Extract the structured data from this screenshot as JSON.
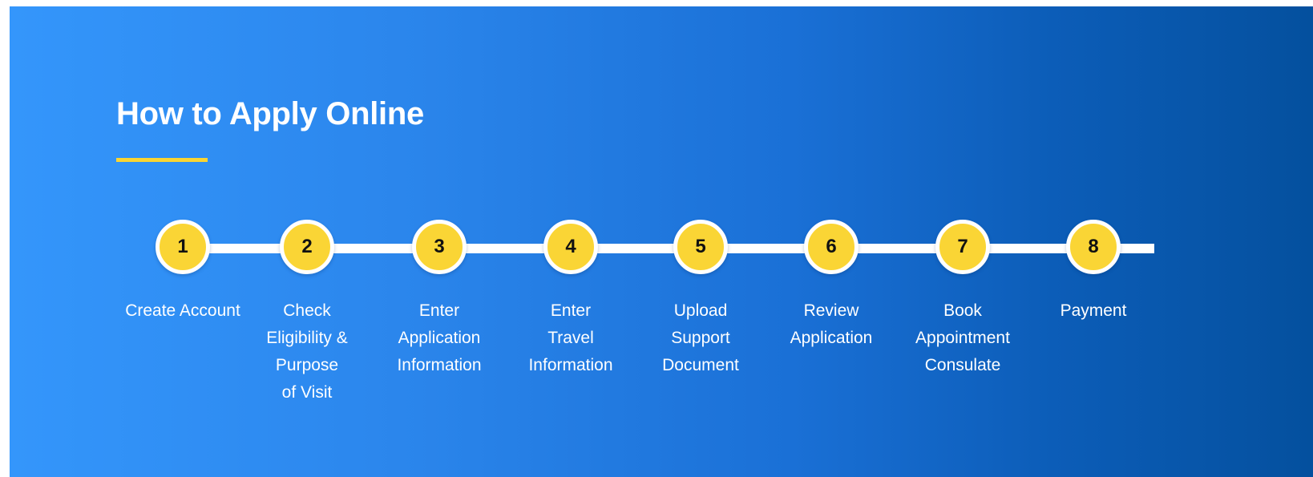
{
  "title": "How to Apply Online",
  "colors": {
    "background_start": "#3496fb",
    "background_end": "#04509e",
    "accent": "#fad535",
    "text": "#ffffff",
    "step_number": "#111111"
  },
  "steps": [
    {
      "number": "1",
      "lines": [
        "Create Account"
      ]
    },
    {
      "number": "2",
      "lines": [
        "Check",
        "Eligibility &",
        "Purpose",
        "of Visit"
      ]
    },
    {
      "number": "3",
      "lines": [
        "Enter",
        "Application",
        "Information"
      ]
    },
    {
      "number": "4",
      "lines": [
        "Enter",
        "Travel",
        "Information"
      ]
    },
    {
      "number": "5",
      "lines": [
        "Upload",
        "Support",
        "Document"
      ]
    },
    {
      "number": "6",
      "lines": [
        "Review",
        "Application"
      ]
    },
    {
      "number": "7",
      "lines": [
        "Book",
        "Appointment",
        "Consulate"
      ]
    },
    {
      "number": "8",
      "lines": [
        "Payment"
      ]
    }
  ]
}
